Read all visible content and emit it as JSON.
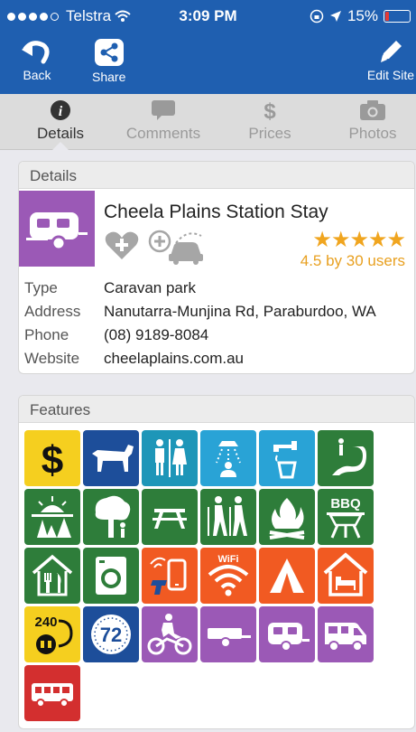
{
  "status_bar": {
    "carrier": "Telstra",
    "time": "3:09 PM",
    "battery": "15%"
  },
  "nav": {
    "back_label": "Back",
    "share_label": "Share",
    "edit_label": "Edit Site"
  },
  "tabs": [
    {
      "label": "Details",
      "icon": "info-icon"
    },
    {
      "label": "Comments",
      "icon": "speech-bubble-icon"
    },
    {
      "label": "Prices",
      "icon": "dollar-icon"
    },
    {
      "label": "Photos",
      "icon": "camera-icon"
    }
  ],
  "details": {
    "header": "Details",
    "name": "Cheela Plains Station Stay",
    "stars": "★★★★★",
    "rating_text": "4.5 by 30 users",
    "rows": [
      {
        "key": "Type",
        "value": "Caravan park"
      },
      {
        "key": "Address",
        "value": "Nanutarra-Munjina Rd, Paraburdoo, WA"
      },
      {
        "key": "Phone",
        "value": "(08) 9189-8084"
      },
      {
        "key": "Website",
        "value": "cheelaplains.com.au"
      }
    ]
  },
  "features": {
    "header": "Features",
    "items": [
      {
        "name": "dollar-fee-icon",
        "color": "#f5cf1f"
      },
      {
        "name": "dog-icon",
        "color": "#1d4e9a"
      },
      {
        "name": "toilets-icon",
        "color": "#1e96b8"
      },
      {
        "name": "shower-icon",
        "color": "#29a3d6"
      },
      {
        "name": "drinking-water-icon",
        "color": "#29a3d6"
      },
      {
        "name": "dump-point-icon",
        "color": "#2e7d3a"
      },
      {
        "name": "sunrise-trees-icon",
        "color": "#2e7d3a"
      },
      {
        "name": "shade-tree-icon",
        "color": "#2e7d3a"
      },
      {
        "name": "picnic-table-icon",
        "color": "#2e7d3a"
      },
      {
        "name": "hiking-icon",
        "color": "#2e7d3a"
      },
      {
        "name": "campfire-icon",
        "color": "#2e7d3a"
      },
      {
        "name": "bbq-icon",
        "color": "#2e7d3a",
        "label": "BBQ"
      },
      {
        "name": "restaurant-icon",
        "color": "#2e7d3a"
      },
      {
        "name": "laundry-icon",
        "color": "#2e7d3a"
      },
      {
        "name": "telstra-phone-icon",
        "color": "#f15a22"
      },
      {
        "name": "wifi-icon",
        "color": "#f15a22",
        "label": "WiFi"
      },
      {
        "name": "tent-icon",
        "color": "#f15a22"
      },
      {
        "name": "cabin-icon",
        "color": "#f15a22"
      },
      {
        "name": "power-240-icon",
        "color": "#f5cf1f",
        "label": "240"
      },
      {
        "name": "max-stay-72-icon",
        "color": "#1d4e9a",
        "label": "72"
      },
      {
        "name": "motorbike-icon",
        "color": "#9b59b6"
      },
      {
        "name": "trailer-icon",
        "color": "#9b59b6"
      },
      {
        "name": "caravan-icon",
        "color": "#9b59b6"
      },
      {
        "name": "motorhome-icon",
        "color": "#9b59b6"
      },
      {
        "name": "bus-icon",
        "color": "#d32f2f"
      }
    ]
  }
}
